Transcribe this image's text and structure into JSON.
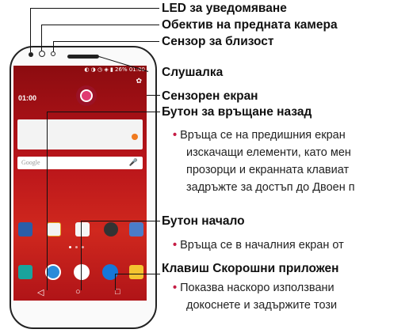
{
  "labels": {
    "led": "LED за уведомяване",
    "front_camera": "Обектив на предната камера",
    "proximity": "Сензор за близост",
    "earpiece": "Слушалка",
    "touchscreen": "Сензорен екран",
    "back_button": "Бутон за връщане назад",
    "home_button": "Бутон начало",
    "recent_apps": "Клавиш Скорошни приложен"
  },
  "descriptions": {
    "back_line1": "Връща се на предишния екран",
    "back_line2": "изскачащи елементи, като мен",
    "back_line3": "прозорци и екранната клавиат",
    "back_line4": "задръжте за достъп до Двоен п",
    "home_line1": "Връща се в началния екран от",
    "recent_line1": "Показва наскоро използвани",
    "recent_line2": "докоснете и задържите този"
  },
  "screen": {
    "status_text": "26% 01:00",
    "clock": "01:00",
    "search_placeholder": "Google"
  },
  "colors": {
    "bullet": "#c51c44",
    "screen_red": "#b8141a"
  }
}
